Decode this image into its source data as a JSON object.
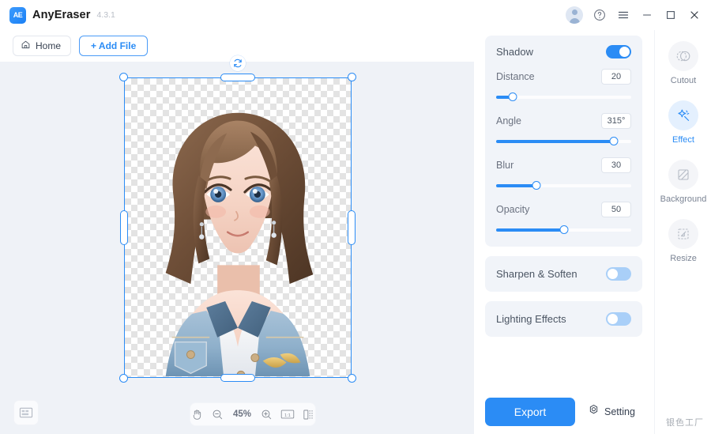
{
  "titlebar": {
    "logo_text": "AE",
    "app_name": "AnyEraser",
    "version": "4.3.1",
    "avatar_icon": "user-avatar-icon",
    "help_icon": "question-circle-icon",
    "menu_icon": "hamburger-menu-icon",
    "minimize_icon": "minimize-icon",
    "maximize_icon": "maximize-icon",
    "close_icon": "close-icon"
  },
  "subbar": {
    "home_label": "Home",
    "home_icon": "home-icon",
    "add_file_label": "+ Add File"
  },
  "canvas": {
    "rotate_icon": "rotate-handle-icon",
    "layers_icon": "layers-panel-icon"
  },
  "zoombar": {
    "hand_icon": "hand-tool-icon",
    "zoom_out_icon": "zoom-out-icon",
    "zoom_level": "45%",
    "zoom_in_icon": "zoom-in-icon",
    "actual_size_label": "1:1",
    "compare_icon": "split-compare-icon"
  },
  "panel": {
    "shadow": {
      "title": "Shadow",
      "enabled": true,
      "params": [
        {
          "label": "Distance",
          "value": "20",
          "percent": 12
        },
        {
          "label": "Angle",
          "value": "315°",
          "percent": 87
        },
        {
          "label": "Blur",
          "value": "30",
          "percent": 30
        },
        {
          "label": "Opacity",
          "value": "50",
          "percent": 50
        }
      ]
    },
    "sharpen": {
      "title": "Sharpen & Soften",
      "enabled": false
    },
    "lighting": {
      "title": "Lighting Effects",
      "enabled": false
    }
  },
  "footer": {
    "export_label": "Export",
    "setting_label": "Setting",
    "setting_icon": "gear-icon"
  },
  "rail": {
    "items": [
      {
        "label": "Cutout",
        "icon": "cutout-icon",
        "active": false
      },
      {
        "label": "Effect",
        "icon": "magic-wand-effect-icon",
        "active": true
      },
      {
        "label": "Background",
        "icon": "background-icon",
        "active": false
      },
      {
        "label": "Resize",
        "icon": "resize-icon",
        "active": false
      }
    ]
  },
  "watermark": {
    "text": "银色工厂"
  },
  "colors": {
    "accent": "#2b8cf5",
    "canvas_bg": "#eff2f7",
    "card_bg": "#f1f4f9"
  }
}
